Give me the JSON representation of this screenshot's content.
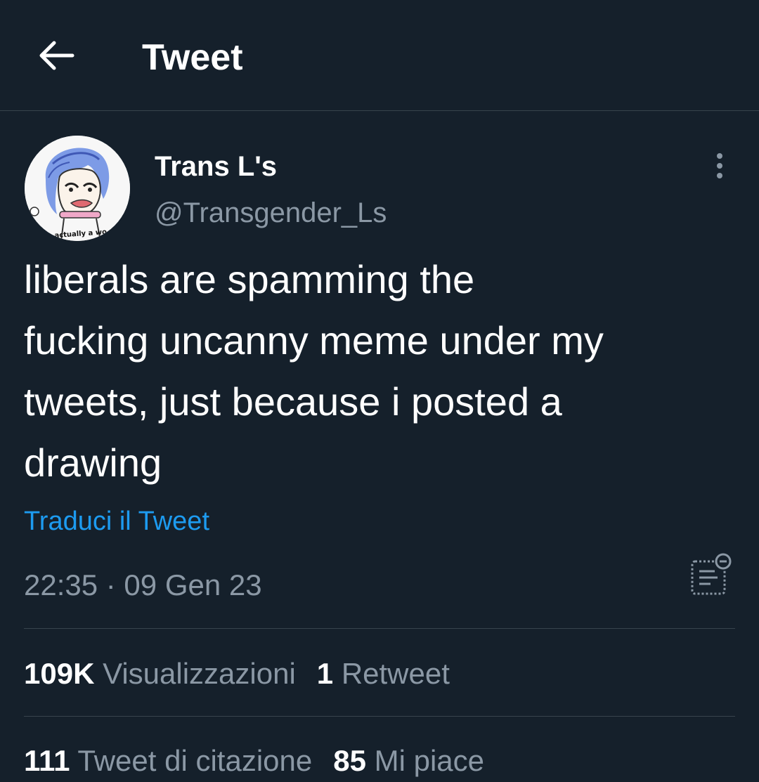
{
  "header": {
    "title": "Tweet",
    "back_icon": "arrow-left-icon"
  },
  "tweet": {
    "author": {
      "name": "Trans L's",
      "handle": "@Transgender_Ls",
      "avatar_caption": "i'm actually a wo"
    },
    "text": "liberals are spamming the\nfucking uncanny meme under my\ntweets, just because i posted a\ndrawing",
    "translate_label": "Traduci il Tweet",
    "timestamp": "22:35 · 09 Gen 23",
    "more_icon": "more-vertical-icon",
    "notes_icon": "notes-icon"
  },
  "stats": {
    "views": {
      "value": "109K",
      "label": "Visualizzazioni"
    },
    "retweets": {
      "value": "1",
      "label": "Retweet"
    },
    "quotes": {
      "value": "111",
      "label": "Tweet di citazione"
    },
    "likes": {
      "value": "85",
      "label": "Mi piace"
    }
  },
  "colors": {
    "background": "#15202b",
    "accent": "#1d9bf0",
    "secondary_text": "#8b98a5",
    "divider": "#38444d"
  }
}
